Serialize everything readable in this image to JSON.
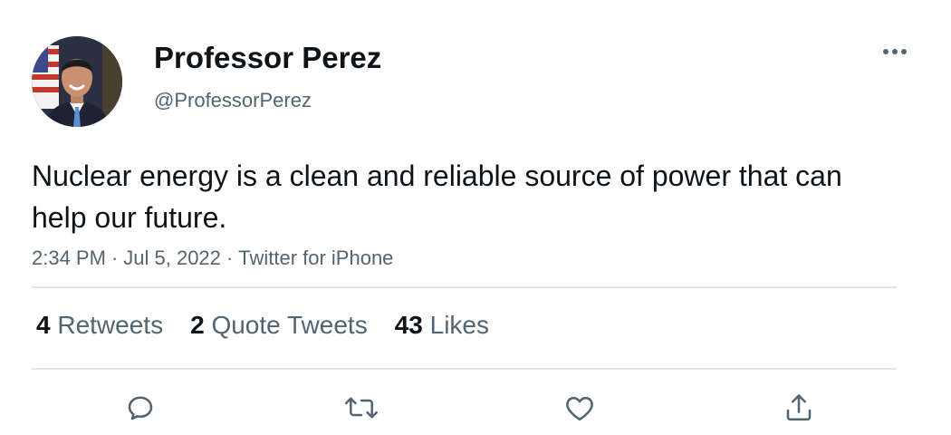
{
  "author": {
    "display_name": "Professor Perez",
    "handle": "@ProfessorPerez",
    "avatar_icon": "profile-photo"
  },
  "tweet": {
    "text": "Nuclear energy is a clean and reliable source of power that can help our future."
  },
  "meta": {
    "time": "2:34 PM",
    "date": "Jul 5, 2022",
    "source": "Twitter for iPhone",
    "separator": "·"
  },
  "stats": {
    "retweets": {
      "count": "4",
      "label": "Retweets"
    },
    "quotes": {
      "count": "2",
      "label": "Quote Tweets"
    },
    "likes": {
      "count": "43",
      "label": "Likes"
    }
  },
  "actions": {
    "icons": [
      "reply-icon",
      "retweet-icon",
      "like-icon",
      "share-icon"
    ]
  },
  "colors": {
    "text_primary": "#0f1419",
    "text_secondary": "#536471",
    "divider": "#e1e6ea",
    "icon": "#536471"
  }
}
